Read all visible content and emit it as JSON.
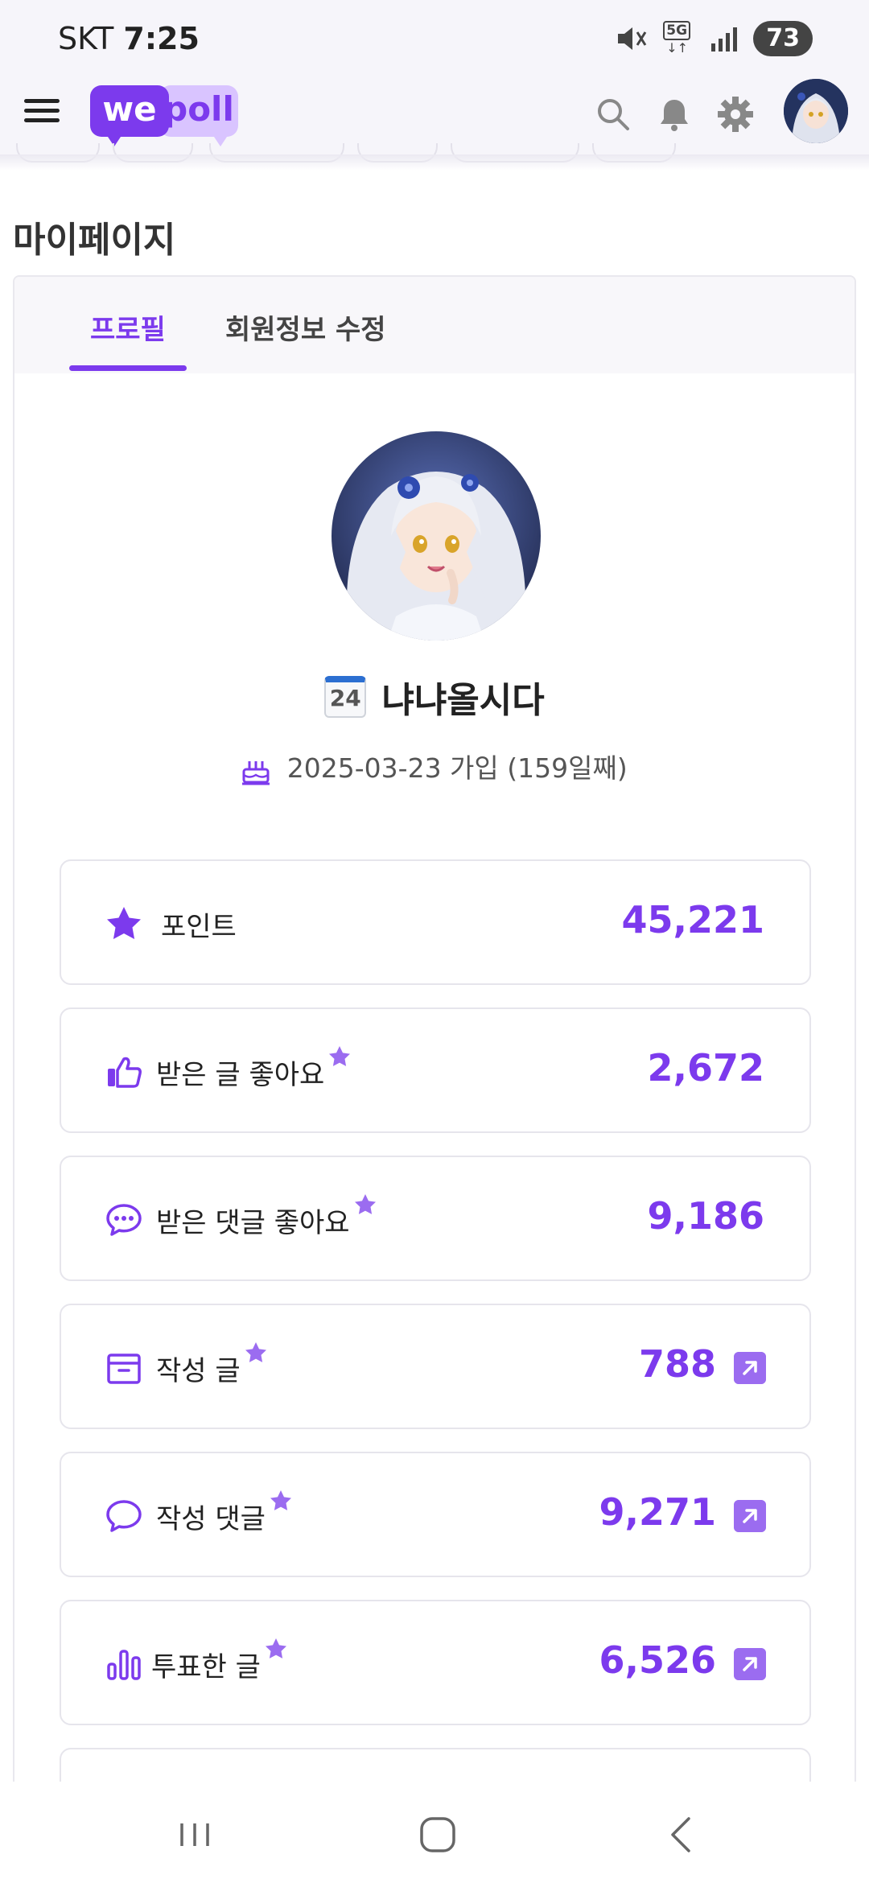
{
  "status_bar": {
    "carrier": "SKT",
    "time": "7:25",
    "battery": "73",
    "network": "5G"
  },
  "header": {
    "logo_we": "we",
    "logo_poll": "poll",
    "icons": [
      "menu-icon",
      "search-icon",
      "bell-icon",
      "gear-icon",
      "avatar"
    ]
  },
  "page": {
    "title": "마이페이지"
  },
  "tabs": [
    {
      "label": "프로필",
      "active": true
    },
    {
      "label": "회원정보 수정",
      "active": false
    }
  ],
  "profile": {
    "calendar_badge": "24",
    "nickname": "냐냐올시다",
    "joined": "2025-03-23 가입 (159일째)"
  },
  "stats": [
    {
      "icon": "star-icon",
      "label": "포인트",
      "value": "45,221",
      "star": false,
      "link": false
    },
    {
      "icon": "thumbs-up-icon",
      "label": "받은 글 좋아요",
      "value": "2,672",
      "star": true,
      "link": false
    },
    {
      "icon": "chat-dots-icon",
      "label": "받은 댓글 좋아요",
      "value": "9,186",
      "star": true,
      "link": false
    },
    {
      "icon": "archive-icon",
      "label": "작성 글",
      "value": "788",
      "star": true,
      "link": true
    },
    {
      "icon": "chat-bubble-icon",
      "label": "작성 댓글",
      "value": "9,271",
      "star": true,
      "link": true
    },
    {
      "icon": "bar-chart-icon",
      "label": "투표한 글",
      "value": "6,526",
      "star": true,
      "link": true
    }
  ],
  "colors": {
    "accent": "#7c3aed",
    "accent_light": "#d9c4ff",
    "link_bg": "#9b6cf0"
  }
}
